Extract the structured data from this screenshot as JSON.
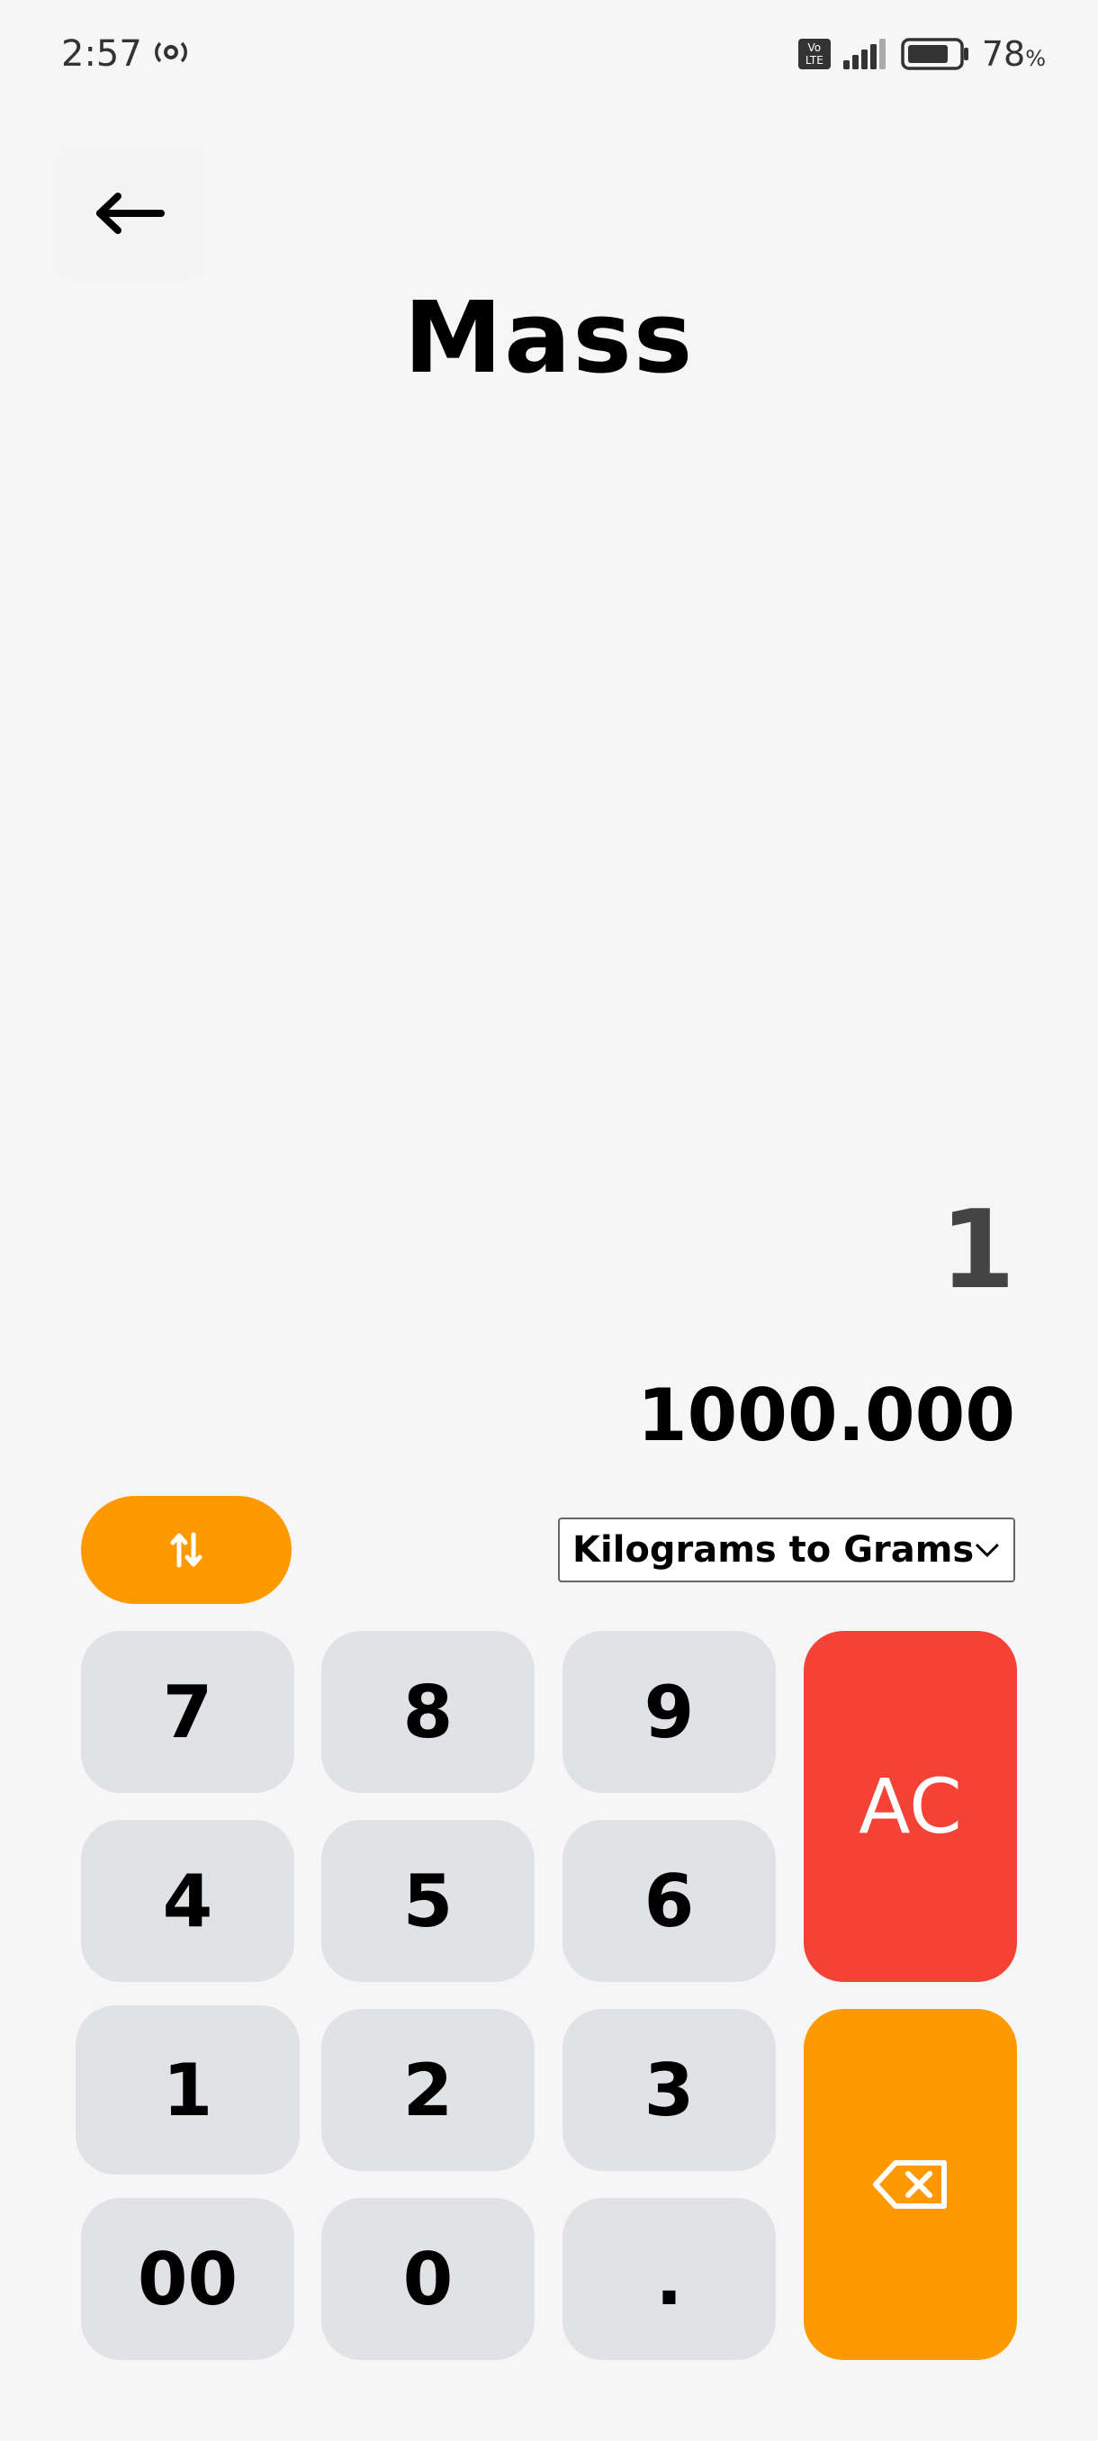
{
  "status_bar": {
    "time": "2:57",
    "volte_top": "Vo",
    "volte_bottom": "LTE",
    "battery_percent": "78",
    "battery_unit": "%"
  },
  "header": {
    "title": "Mass"
  },
  "display": {
    "input_value": "1",
    "result_value": "1000.000"
  },
  "controls": {
    "conversion_selected": "Kilograms to Grams"
  },
  "keypad": {
    "k7": "7",
    "k8": "8",
    "k9": "9",
    "k4": "4",
    "k5": "5",
    "k6": "6",
    "k1": "1",
    "k2": "2",
    "k3": "3",
    "k00": "00",
    "k0": "0",
    "kdot": ".",
    "clear": "AC"
  },
  "icons": {
    "back": "arrow-left-icon",
    "swap": "swap-vertical-icon",
    "backspace": "backspace-icon",
    "dropdown": "chevron-down-icon"
  },
  "colors": {
    "accent_orange": "#ff9900",
    "clear_red": "#f44336",
    "key_gray": "#e1e2e6",
    "background": "#f6f6f6"
  }
}
